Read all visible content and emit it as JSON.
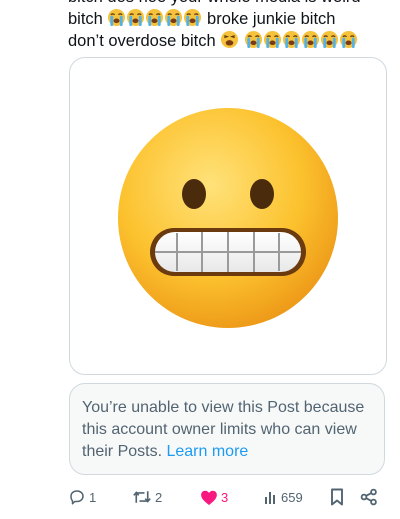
{
  "tweet": {
    "line1": "bitch dos hoe your whole media is weird",
    "line2_start": "bitch",
    "line2_end": "broke junkie bitch",
    "line3_start": "don’t overdose bitch",
    "emoji_names": {
      "crying": "loudly-crying-face-emoji",
      "weary": "weary-face-emoji",
      "grimace": "grimacing-face-emoji"
    }
  },
  "notice": {
    "text": "You’re unable to view this Post because this account owner limits who can view their Posts.",
    "link": "Learn more"
  },
  "actions": {
    "reply_count": "1",
    "repost_count": "2",
    "like_count": "3",
    "views_count": "659"
  },
  "colors": {
    "text": "#0f1419",
    "muted": "#536471",
    "link": "#1d9bf0",
    "like": "#f91880",
    "border": "#cfd9de",
    "notice_bg": "#f7f9f9"
  }
}
